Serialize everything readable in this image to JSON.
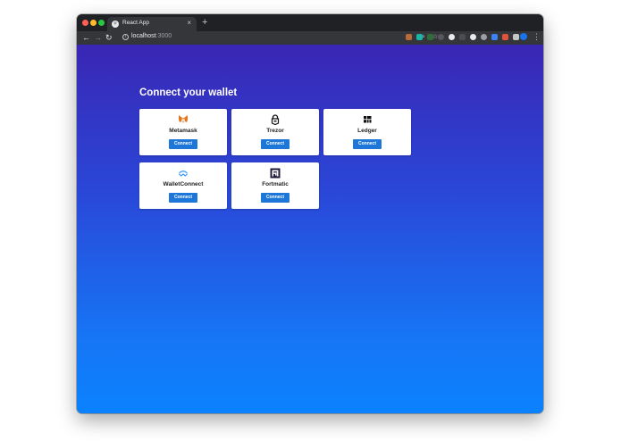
{
  "browser": {
    "tab_title": "React App",
    "tab_close": "×",
    "new_tab": "+",
    "url_host": "localhost",
    "url_port": ":3000"
  },
  "page": {
    "heading": "Connect your wallet",
    "wallets": [
      {
        "label": "Metamask",
        "button": "Connect",
        "icon": "metamask-fox-icon"
      },
      {
        "label": "Trezor",
        "button": "Connect",
        "icon": "trezor-lock-icon"
      },
      {
        "label": "Ledger",
        "button": "Connect",
        "icon": "ledger-icon"
      },
      {
        "label": "WalletConnect",
        "button": "Connect",
        "icon": "walletconnect-icon"
      },
      {
        "label": "Fortmatic",
        "button": "Connect",
        "icon": "fortmatic-icon"
      }
    ]
  },
  "colors": {
    "button": "#1c77d9",
    "gradient_top": "#3a26b4",
    "gradient_bottom": "#0a82ff"
  }
}
